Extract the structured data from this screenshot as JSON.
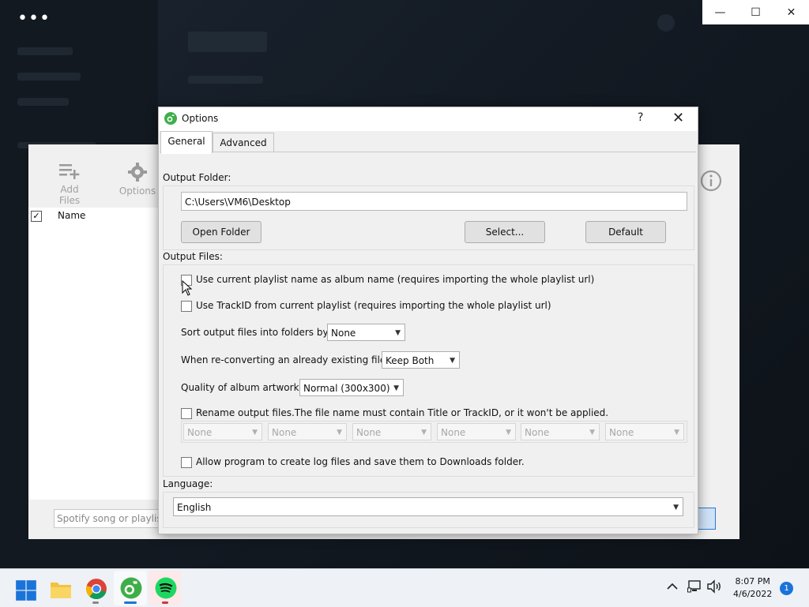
{
  "background_app": {
    "menu_dots": "•••",
    "window_controls": {
      "minimize": "—",
      "maximize": "☐",
      "close": "✕"
    }
  },
  "converter": {
    "toolbar": {
      "add_files": "Add Files",
      "options": "Options"
    },
    "list": {
      "column_name": "Name",
      "select_all_check": "✓"
    },
    "url_placeholder": "Spotify song or playlist"
  },
  "dialog": {
    "title": "Options",
    "help": "?",
    "close": "✕",
    "tabs": [
      {
        "label": "General"
      },
      {
        "label": "Advanced"
      }
    ],
    "output_folder": {
      "label": "Output Folder:",
      "path": "C:\\Users\\VM6\\Desktop",
      "open_button": "Open Folder",
      "select_button": "Select...",
      "default_button": "Default"
    },
    "output_files": {
      "label": "Output Files:",
      "use_playlist_name": "Use current playlist name as album name (requires importing the whole playlist url)",
      "use_trackid": "Use TrackID from current playlist (requires importing the whole playlist url)",
      "sort_label": "Sort output files into folders by:",
      "sort_value": "None",
      "reconvert_label": "When re-converting an already existing file:",
      "reconvert_value": "Keep Both",
      "artwork_label": "Quality of album artwork:",
      "artwork_value": "Normal (300x300)",
      "rename_label": "Rename output files.The file name must contain Title or TrackID, or it won't be applied.",
      "rename_slots": [
        "None",
        "None",
        "None",
        "None",
        "None",
        "None"
      ],
      "log_label": "Allow program to create log files and save them to Downloads folder."
    },
    "language": {
      "label": "Language:",
      "value": "English"
    }
  },
  "taskbar": {
    "time": "8:07 PM",
    "date": "4/6/2022",
    "notification_count": "1"
  }
}
